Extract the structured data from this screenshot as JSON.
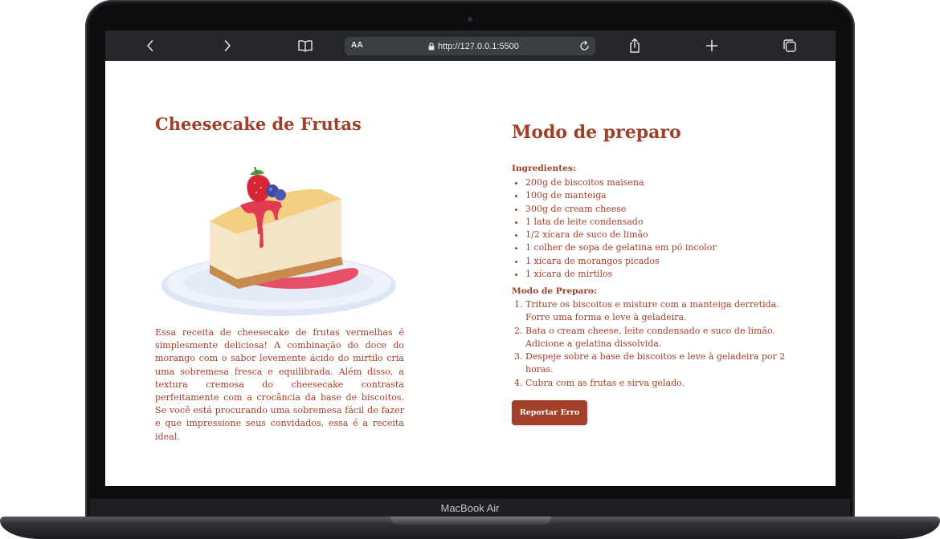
{
  "device": {
    "label": "MacBook Air"
  },
  "browser": {
    "reader_label": "AA",
    "url": "http://127.0.0.1:5500",
    "icons": [
      "chevron-left-icon",
      "chevron-right-icon",
      "book-icon",
      "lock-icon",
      "reload-icon",
      "share-icon",
      "plus-icon",
      "tabs-icon"
    ]
  },
  "recipe": {
    "title": "Cheesecake de Frutas",
    "image": "cheesecake-slice-illustration",
    "description": "Essa receita de cheesecake de frutas vermelhas é simplesmente deliciosa! A combinação do doce do morango com o sabor levemente ácido do mirtilo cria uma sobremesa fresca e equilibrada. Além disso, a textura cremosa do cheesecake contrasta perfeitamente com a crocância da base de biscoitos. Se você está procurando uma sobremesa fácil de fazer e que impressione seus convidados, essa é a receita ideal."
  },
  "method": {
    "title": "Modo de preparo",
    "ingredients_label": "Ingredientes:",
    "ingredients": [
      "200g de biscoitos maisena",
      "100g de manteiga",
      "300g de cream cheese",
      "1 lata de leite condensado",
      "1/2 xícara de suco de limão",
      "1 colher de sopa de gelatina em pó incolor",
      "1 xícara de morangos picados",
      "1 xícara de mirtilos"
    ],
    "steps_label": "Modo de Preparo:",
    "steps": [
      "Triture os biscoitos e misture com a manteiga derretida. Forre uma forma e leve à geladeira.",
      "Bata o cream cheese, leite condensado e suco de limão. Adicione a gelatina dissolvida.",
      "Despeje sobre a base de biscoitos e leve à geladeira por 2 horas.",
      "Cubra com as frutas e sirva gelado."
    ],
    "report_button": "Reportar Erro"
  },
  "colors": {
    "accent": "#a1402a",
    "toolbar": "#25272b",
    "address_bar": "#3b3e43"
  }
}
